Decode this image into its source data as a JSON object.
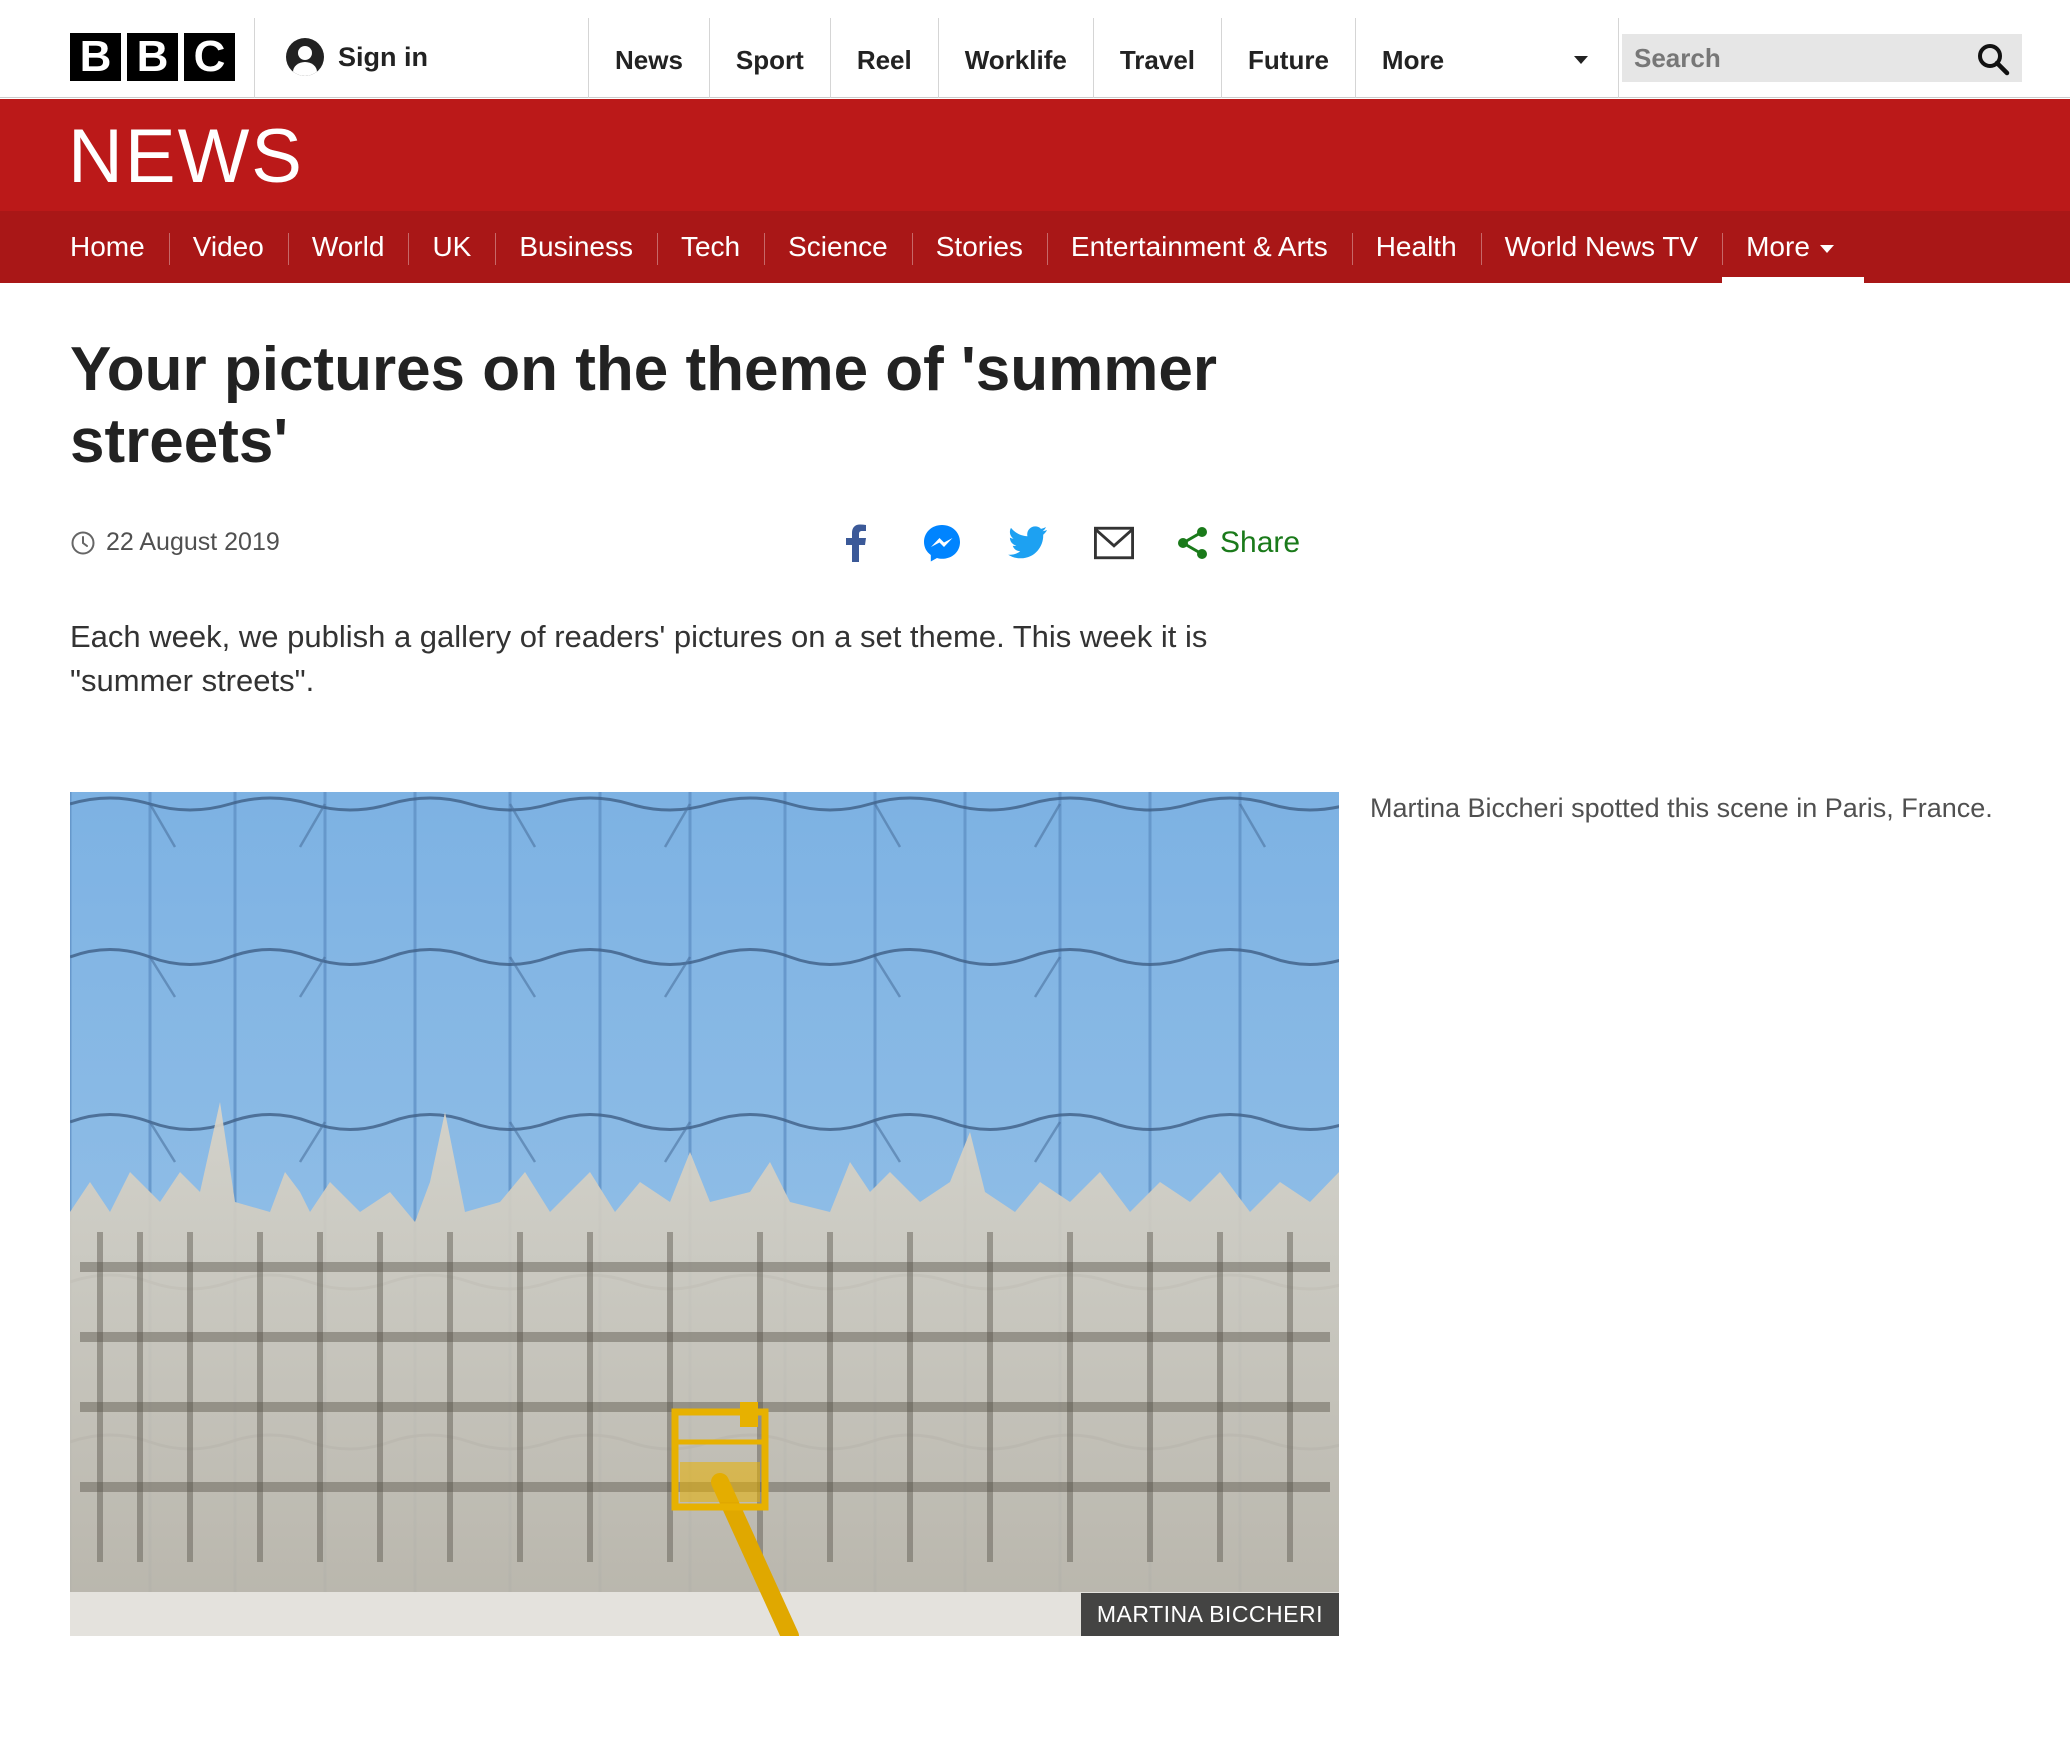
{
  "brand": {
    "letters": [
      "B",
      "B",
      "C"
    ],
    "section": "NEWS"
  },
  "account": {
    "signin_label": "Sign in"
  },
  "top_nav": [
    "News",
    "Sport",
    "Reel",
    "Worklife",
    "Travel",
    "Future"
  ],
  "top_nav_more": "More",
  "search": {
    "placeholder": "Search"
  },
  "sub_nav": [
    "Home",
    "Video",
    "World",
    "UK",
    "Business",
    "Tech",
    "Science",
    "Stories",
    "Entertainment & Arts",
    "Health",
    "World News TV"
  ],
  "sub_nav_more": "More",
  "article": {
    "headline": "Your pictures on the theme of 'summer streets'",
    "date": "22 August 2019",
    "share_label": "Share",
    "intro": "Each week, we publish a gallery of readers' pictures on a set theme. This week it is \"summer streets\".",
    "photo_credit": "MARTINA BICCHERI",
    "caption": "Martina Biccheri spotted this scene in Paris, France."
  },
  "colors": {
    "news_red": "#bb1919",
    "subnav_red": "#a91717",
    "share_green": "#1a7a1a",
    "facebook": "#3b5998",
    "messenger": "#0084ff",
    "twitter": "#1da1f2"
  },
  "icons": {
    "share": [
      "facebook-icon",
      "messenger-icon",
      "twitter-icon",
      "email-icon",
      "share-icon"
    ],
    "search": "search-icon",
    "account": "avatar-icon",
    "date": "clock-icon"
  }
}
